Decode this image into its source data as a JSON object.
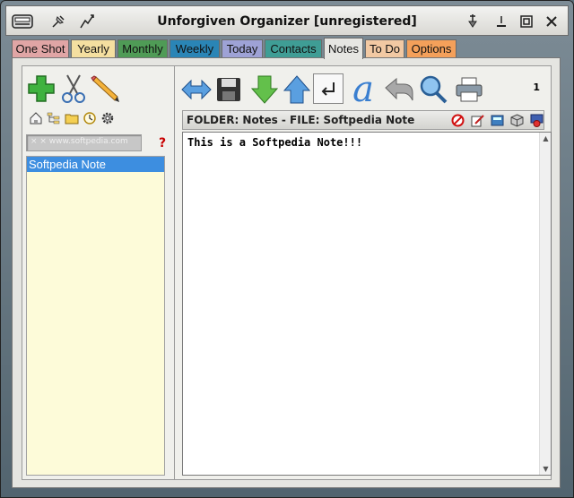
{
  "window": {
    "title": "Unforgiven Organizer [unregistered]"
  },
  "titlebar_icons": {
    "left": [
      "organizer-logo-icon",
      "pin-icon",
      "chart-icon"
    ],
    "right": [
      "pushpin-icon",
      "minimize-icon",
      "maximize-icon",
      "close-icon"
    ]
  },
  "tabs": [
    {
      "label": "One Shot",
      "color": "#e0a5a5"
    },
    {
      "label": "Yearly",
      "color": "#f4dfa0"
    },
    {
      "label": "Monthly",
      "color": "#4f9b56"
    },
    {
      "label": "Weekly",
      "color": "#2a85b6"
    },
    {
      "label": "Today",
      "color": "#9ea2d6"
    },
    {
      "label": "Contacts",
      "color": "#3f9d95"
    },
    {
      "label": "Notes",
      "color": "#e6e6e2"
    },
    {
      "label": "To Do",
      "color": "#f2c9a3"
    },
    {
      "label": "Options",
      "color": "#f4a05a"
    }
  ],
  "active_tab": "Notes",
  "left_toolbar": {
    "big": [
      "add-icon",
      "cut-icon",
      "pencil-icon"
    ],
    "small": [
      "home-icon",
      "tree-icon",
      "folder-icon",
      "clock-icon",
      "gear-icon"
    ]
  },
  "search": {
    "value": "× ×   www.softpedia.com"
  },
  "notes_list": [
    "Softpedia Note"
  ],
  "right_toolbar": [
    "swap-icon",
    "save-icon",
    "down-arrow-icon",
    "up-arrow-icon",
    "return-icon",
    "font-icon",
    "back-icon",
    "search-icon",
    "print-icon"
  ],
  "note_count": "1",
  "folder_bar": {
    "text": "FOLDER: Notes - FILE: Softpedia Note",
    "icons": [
      "stop-icon",
      "edit-icon",
      "calculator-icon",
      "cube-icon",
      "badge-icon"
    ]
  },
  "editor": {
    "content": "This is a Softpedia Note!!!"
  }
}
